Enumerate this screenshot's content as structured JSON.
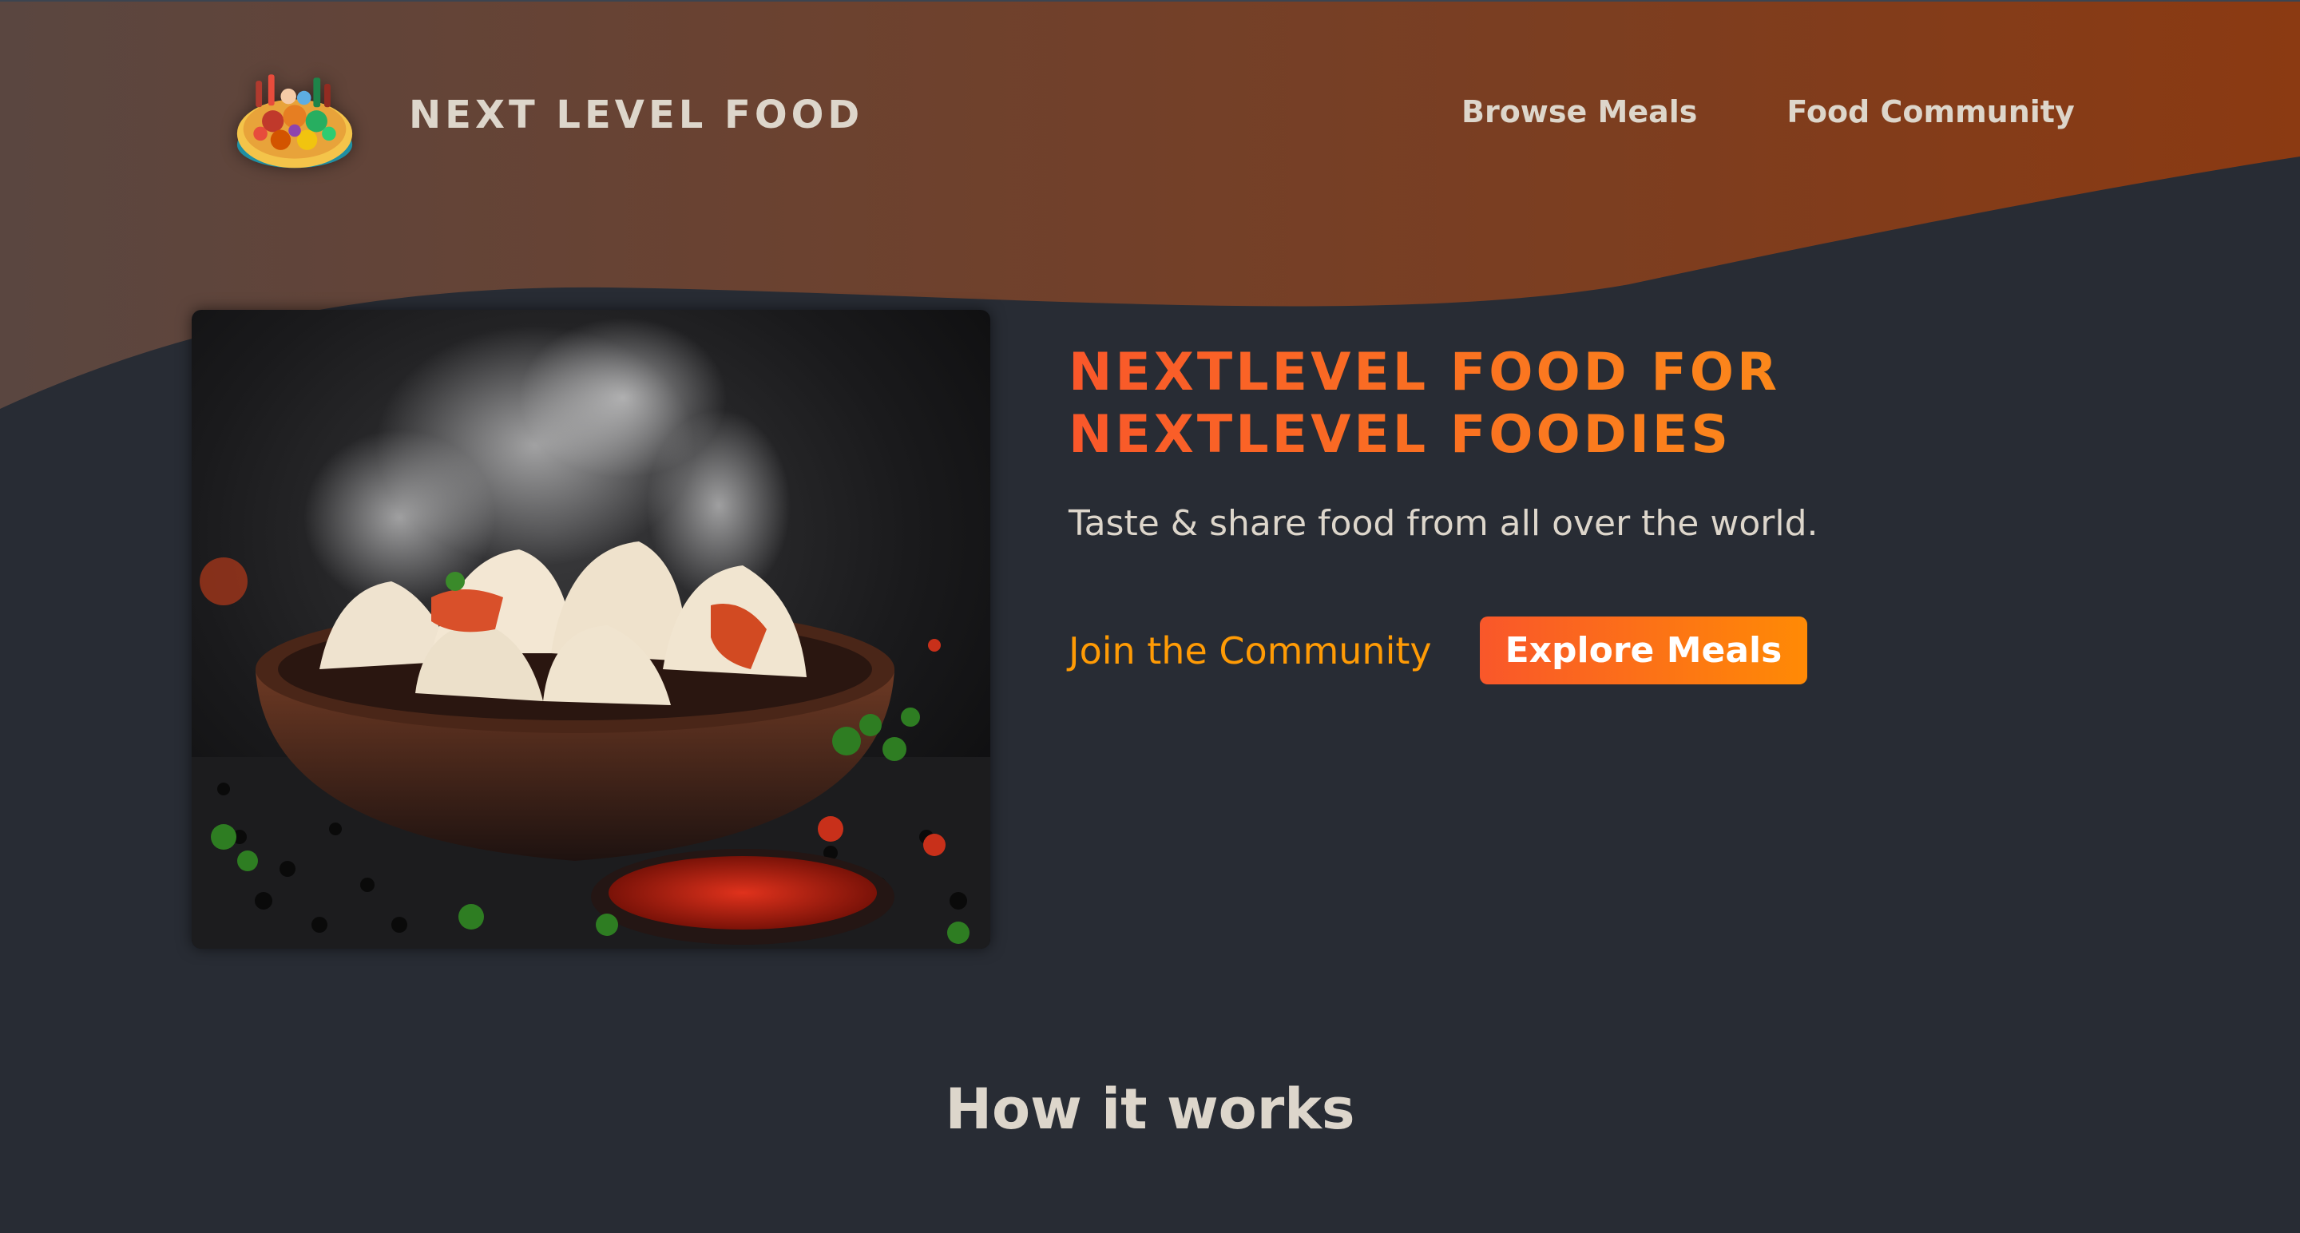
{
  "brand": {
    "name": "NEXT LEVEL FOOD",
    "logo_alt": "A plate with food on it"
  },
  "nav": {
    "items": [
      {
        "label": "Browse Meals"
      },
      {
        "label": "Food Community"
      }
    ]
  },
  "hero": {
    "image_alt": "Steaming dumplings in a bowl with chili sauce",
    "title_line1": "NEXTLEVEL FOOD FOR",
    "title_line2": "NEXTLEVEL FOODIES",
    "subtitle": "Taste & share food from all over the world.",
    "join_label": "Join the Community",
    "explore_label": "Explore Meals"
  },
  "section": {
    "title": "How it works"
  },
  "colors": {
    "background": "#282c34",
    "header_gradient_start": "#5a4640",
    "header_gradient_end": "#8b3a12",
    "accent_orange": "#f9572a",
    "accent_amber": "#ff9b05",
    "text": "#ddd6cb"
  }
}
